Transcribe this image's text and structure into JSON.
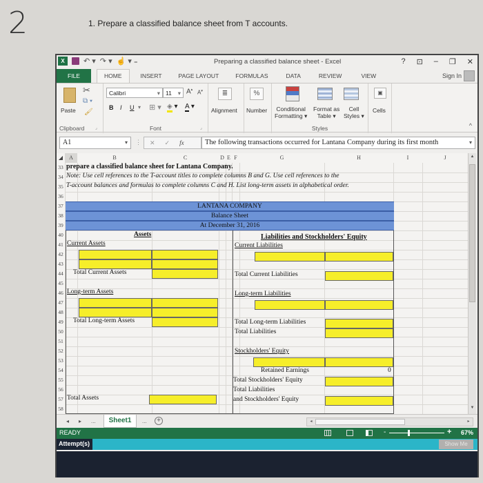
{
  "question": {
    "number": "2",
    "text": "1. Prepare a classified balance sheet from T accounts."
  },
  "window": {
    "title": "Preparing a classified balance sheet - Excel",
    "controls": [
      "?",
      "⊡",
      "–",
      "🗗",
      "✕"
    ],
    "sign_in": "Sign In"
  },
  "tabs": [
    "FILE",
    "HOME",
    "INSERT",
    "PAGE LAYOUT",
    "FORMULAS",
    "DATA",
    "REVIEW",
    "VIEW"
  ],
  "ribbon": {
    "clipboard": {
      "paste": "Paste",
      "label": "Clipboard"
    },
    "font": {
      "name": "Calibri",
      "size": "11",
      "bold": "B",
      "italic": "I",
      "underline": "U",
      "label": "Font"
    },
    "alignment": "Alignment",
    "number": "Number",
    "styles": {
      "conditional_1": "Conditional",
      "conditional_2": "Formatting ▾",
      "table_1": "Format as",
      "table_2": "Table ▾",
      "cell_1": "Cell",
      "cell_2": "Styles ▾",
      "label": "Styles"
    },
    "cells": "Cells"
  },
  "formula_bar": {
    "name_box": "A1",
    "formula": "The following transactions occurred for Lantana Company during its first month"
  },
  "columns": [
    "A",
    "B",
    "C",
    "D",
    "E",
    "F",
    "G",
    "H",
    "I",
    "J"
  ],
  "rows": [
    "33",
    "34",
    "35",
    "36",
    "37",
    "38",
    "39",
    "40",
    "41",
    "42",
    "43",
    "44",
    "45",
    "46",
    "47",
    "48",
    "49",
    "50",
    "51",
    "52",
    "53",
    "54",
    "55",
    "56",
    "57",
    "58"
  ],
  "sheet": {
    "r33": "prepare a classified balance sheet for Lantana Company.",
    "r34": "Note: Use cell references to the T-account titles to complete columns B and G.  Use cell references to the",
    "r35": "T-account balances and formulas to complete columns C and H.  List long-term assets in alphabetical order.",
    "company": "LANTANA COMPANY",
    "statement": "Balance Sheet",
    "date": "At December 31, 2016",
    "assets_header": "Assets",
    "liab_header": "Liabilities and Stockholders' Equity",
    "current_assets": "Current Assets",
    "current_liabilities": "Current Liabilities",
    "total_current_assets": "Total Current Assets",
    "total_current_liabilities": "Total Current Liabilities",
    "long_term_assets": "Long-term Assets",
    "long_term_liabilities": "Long-term Liabilities",
    "total_long_term_assets": "Total Long-term Assets",
    "total_long_term_liabilities": "Total Long-term Liabilities",
    "total_liabilities": "Total Liabilities",
    "stockholders_equity": "Stockholders' Equity",
    "retained_earnings": "Retained Earnings",
    "retained_earnings_value": "0",
    "total_stockholders_equity": "Total Stockholders' Equity",
    "total_liab_se_1": "Total Liabilities",
    "total_liab_se_2": "and Stockholders' Equity",
    "total_assets": "Total Assets"
  },
  "sheet_tabs": {
    "active": "Sheet1",
    "more": "..."
  },
  "status": {
    "ready": "READY",
    "zoom": "67%"
  },
  "footer": {
    "attempts": "Attempt(s)",
    "show_me": "Show Me"
  }
}
